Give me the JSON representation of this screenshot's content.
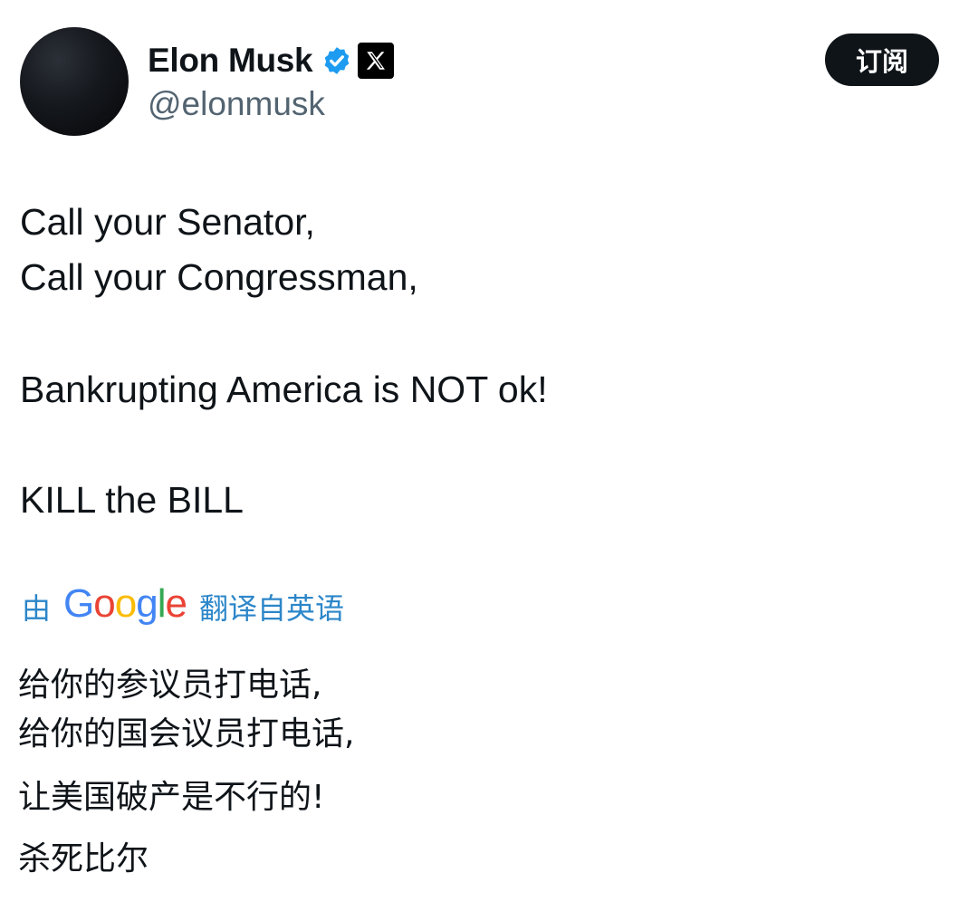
{
  "author": {
    "display_name": "Elon Musk",
    "handle": "@elonmusk",
    "verified_icon": "verified-badge-icon",
    "affiliation_icon": "x-logo-icon",
    "colors": {
      "verified": "#1d9bf0",
      "handle": "#536471"
    }
  },
  "subscribe_button": {
    "label": "订阅"
  },
  "tweet": {
    "lines": [
      "Call your Senator,",
      "Call your Congressman,",
      "Bankrupting America is NOT ok!",
      "KILL the BILL"
    ]
  },
  "translation": {
    "prefix": "由",
    "provider": "Google",
    "suffix": "翻译自英语",
    "lines": [
      "给你的参议员打电话,",
      "给你的国会议员打电话,",
      "让美国破产是不行的!",
      "杀死比尔"
    ],
    "colors": {
      "link": "#2c86c9"
    }
  }
}
